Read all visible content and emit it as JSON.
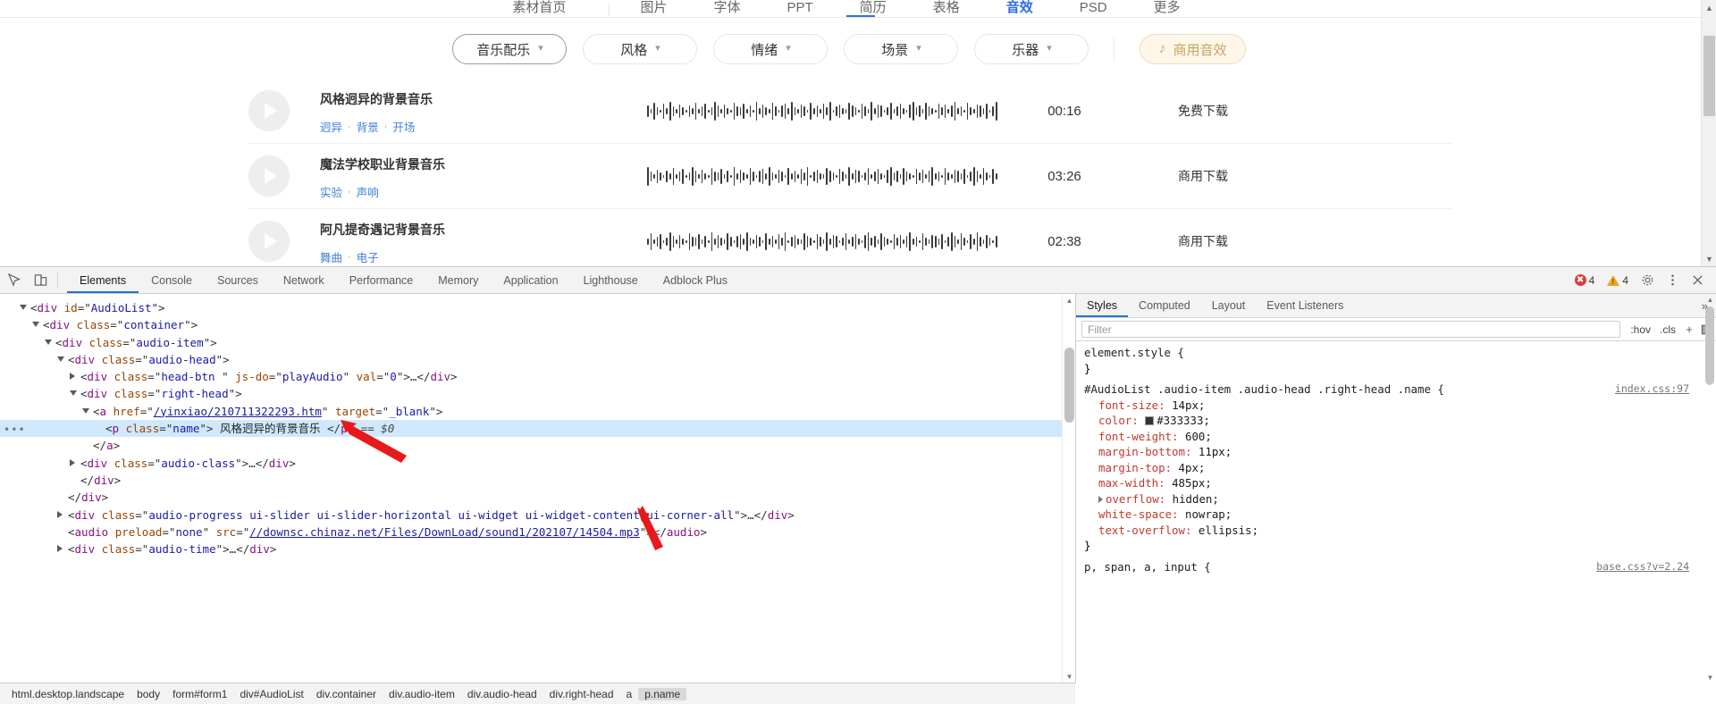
{
  "page": {
    "topnav": {
      "items": [
        "素材首页",
        "图片",
        "字体",
        "PPT",
        "简历",
        "表格",
        "音效",
        "PSD",
        "更多"
      ],
      "active": "音效",
      "more_label": "更多"
    },
    "filters": [
      {
        "label": "音乐配乐",
        "chevron": "chevron-down-icon",
        "selected": true
      },
      {
        "label": "风格",
        "chevron": "chevron-down-icon",
        "selected": false
      },
      {
        "label": "情绪",
        "chevron": "chevron-down-icon",
        "selected": false
      },
      {
        "label": "场景",
        "chevron": "chevron-down-icon",
        "selected": false
      },
      {
        "label": "乐器",
        "chevron": "chevron-down-icon",
        "selected": false
      }
    ],
    "commercial_button": {
      "label": "商用音效",
      "icon": "music-note-icon",
      "color": "#c8a35e",
      "bg": "#fdf6e9"
    },
    "audio_items": [
      {
        "name": "风格迥异的背景音乐",
        "tags": [
          "迥异",
          "背景",
          "开场"
        ],
        "time": "00:16",
        "download": "免费下载",
        "play": "play-icon"
      },
      {
        "name": "魔法学校职业背景音乐",
        "tags": [
          "实验",
          "声响"
        ],
        "time": "03:26",
        "download": "商用下载",
        "play": "play-icon"
      },
      {
        "name": "阿凡提奇遇记背景音乐",
        "tags": [
          "舞曲",
          "电子"
        ],
        "time": "02:38",
        "download": "商用下载",
        "play": "play-icon"
      }
    ]
  },
  "devtools": {
    "toolbar": {
      "inspect_icon": "inspect-element-icon",
      "device_icon": "device-toolbar-icon",
      "tabs": [
        "Elements",
        "Console",
        "Sources",
        "Network",
        "Performance",
        "Memory",
        "Application",
        "Lighthouse",
        "Adblock Plus"
      ],
      "active_tab": "Elements",
      "error_count": "4",
      "warning_count": "4",
      "settings_icon": "gear-icon",
      "more_icon": "kebab-menu-icon",
      "close_icon": "close-icon"
    },
    "dom_lines": [
      {
        "indent": 0,
        "marker": "open",
        "parts": [
          {
            "t": "pk",
            "v": "<"
          },
          {
            "t": "tg",
            "v": "div"
          },
          {
            "t": "pk",
            "v": " "
          },
          {
            "t": "at",
            "v": "id"
          },
          {
            "t": "pk",
            "v": "=\""
          },
          {
            "t": "vl",
            "v": "AudioList"
          },
          {
            "t": "pk",
            "v": "\">"
          }
        ]
      },
      {
        "indent": 1,
        "marker": "open",
        "parts": [
          {
            "t": "pk",
            "v": "<"
          },
          {
            "t": "tg",
            "v": "div"
          },
          {
            "t": "pk",
            "v": " "
          },
          {
            "t": "at",
            "v": "class"
          },
          {
            "t": "pk",
            "v": "=\""
          },
          {
            "t": "vl",
            "v": "container"
          },
          {
            "t": "pk",
            "v": "\">"
          }
        ]
      },
      {
        "indent": 2,
        "marker": "open",
        "parts": [
          {
            "t": "pk",
            "v": "<"
          },
          {
            "t": "tg",
            "v": "div"
          },
          {
            "t": "pk",
            "v": " "
          },
          {
            "t": "at",
            "v": "class"
          },
          {
            "t": "pk",
            "v": "=\""
          },
          {
            "t": "vl",
            "v": "audio-item"
          },
          {
            "t": "pk",
            "v": "\">"
          }
        ]
      },
      {
        "indent": 3,
        "marker": "open",
        "parts": [
          {
            "t": "pk",
            "v": "<"
          },
          {
            "t": "tg",
            "v": "div"
          },
          {
            "t": "pk",
            "v": " "
          },
          {
            "t": "at",
            "v": "class"
          },
          {
            "t": "pk",
            "v": "=\""
          },
          {
            "t": "vl",
            "v": "audio-head"
          },
          {
            "t": "pk",
            "v": "\">"
          }
        ]
      },
      {
        "indent": 4,
        "marker": "closed",
        "parts": [
          {
            "t": "pk",
            "v": "<"
          },
          {
            "t": "tg",
            "v": "div"
          },
          {
            "t": "pk",
            "v": " "
          },
          {
            "t": "at",
            "v": "class"
          },
          {
            "t": "pk",
            "v": "=\""
          },
          {
            "t": "vl",
            "v": "head-btn "
          },
          {
            "t": "pk",
            "v": "\" "
          },
          {
            "t": "at",
            "v": "js-do"
          },
          {
            "t": "pk",
            "v": "=\""
          },
          {
            "t": "vl",
            "v": "playAudio"
          },
          {
            "t": "pk",
            "v": "\" "
          },
          {
            "t": "at",
            "v": "val"
          },
          {
            "t": "pk",
            "v": "=\""
          },
          {
            "t": "vl",
            "v": "0"
          },
          {
            "t": "pk",
            "v": "\">…</"
          },
          {
            "t": "tg",
            "v": "div"
          },
          {
            "t": "pk",
            "v": ">"
          }
        ]
      },
      {
        "indent": 4,
        "marker": "open",
        "parts": [
          {
            "t": "pk",
            "v": "<"
          },
          {
            "t": "tg",
            "v": "div"
          },
          {
            "t": "pk",
            "v": " "
          },
          {
            "t": "at",
            "v": "class"
          },
          {
            "t": "pk",
            "v": "=\""
          },
          {
            "t": "vl",
            "v": "right-head"
          },
          {
            "t": "pk",
            "v": "\">"
          }
        ]
      },
      {
        "indent": 5,
        "marker": "open",
        "parts": [
          {
            "t": "pk",
            "v": "<"
          },
          {
            "t": "tg",
            "v": "a"
          },
          {
            "t": "pk",
            "v": " "
          },
          {
            "t": "at",
            "v": "href"
          },
          {
            "t": "pk",
            "v": "=\""
          },
          {
            "t": "lnk",
            "v": "/yinxiao/210711322293.htm"
          },
          {
            "t": "pk",
            "v": "\" "
          },
          {
            "t": "at",
            "v": "target"
          },
          {
            "t": "pk",
            "v": "=\""
          },
          {
            "t": "vl",
            "v": "_blank"
          },
          {
            "t": "pk",
            "v": "\">"
          }
        ]
      },
      {
        "indent": 6,
        "marker": "none",
        "selected": true,
        "ellipsis": true,
        "parts": [
          {
            "t": "pk",
            "v": "<"
          },
          {
            "t": "tg",
            "v": "p"
          },
          {
            "t": "pk",
            "v": " "
          },
          {
            "t": "at",
            "v": "class"
          },
          {
            "t": "pk",
            "v": "=\""
          },
          {
            "t": "vl",
            "v": "name"
          },
          {
            "t": "pk",
            "v": "\">"
          },
          {
            "t": "txt",
            "v": " 风格迥异的背景音乐 "
          },
          {
            "t": "pk",
            "v": "</"
          },
          {
            "t": "tg",
            "v": "p"
          },
          {
            "t": "pk",
            "v": "> "
          },
          {
            "t": "eq",
            "v": "== $0"
          }
        ]
      },
      {
        "indent": 5,
        "marker": "none",
        "parts": [
          {
            "t": "pk",
            "v": "</"
          },
          {
            "t": "tg",
            "v": "a"
          },
          {
            "t": "pk",
            "v": ">"
          }
        ]
      },
      {
        "indent": 4,
        "marker": "closed",
        "parts": [
          {
            "t": "pk",
            "v": "<"
          },
          {
            "t": "tg",
            "v": "div"
          },
          {
            "t": "pk",
            "v": " "
          },
          {
            "t": "at",
            "v": "class"
          },
          {
            "t": "pk",
            "v": "=\""
          },
          {
            "t": "vl",
            "v": "audio-class"
          },
          {
            "t": "pk",
            "v": "\">…</"
          },
          {
            "t": "tg",
            "v": "div"
          },
          {
            "t": "pk",
            "v": ">"
          }
        ]
      },
      {
        "indent": 4,
        "marker": "none",
        "parts": [
          {
            "t": "pk",
            "v": "</"
          },
          {
            "t": "tg",
            "v": "div"
          },
          {
            "t": "pk",
            "v": ">"
          }
        ]
      },
      {
        "indent": 3,
        "marker": "none",
        "parts": [
          {
            "t": "pk",
            "v": "</"
          },
          {
            "t": "tg",
            "v": "div"
          },
          {
            "t": "pk",
            "v": ">"
          }
        ]
      },
      {
        "indent": 3,
        "marker": "closed",
        "parts": [
          {
            "t": "pk",
            "v": "<"
          },
          {
            "t": "tg",
            "v": "div"
          },
          {
            "t": "pk",
            "v": " "
          },
          {
            "t": "at",
            "v": "class"
          },
          {
            "t": "pk",
            "v": "=\""
          },
          {
            "t": "vl",
            "v": "audio-progress ui-slider ui-slider-horizontal ui-widget ui-widget-content ui-corner-all"
          },
          {
            "t": "pk",
            "v": "\">…</"
          },
          {
            "t": "tg",
            "v": "div"
          },
          {
            "t": "pk",
            "v": ">"
          }
        ]
      },
      {
        "indent": 3,
        "marker": "none",
        "parts": [
          {
            "t": "pk",
            "v": "<"
          },
          {
            "t": "tg",
            "v": "audio"
          },
          {
            "t": "pk",
            "v": " "
          },
          {
            "t": "at",
            "v": "preload"
          },
          {
            "t": "pk",
            "v": "=\""
          },
          {
            "t": "vl",
            "v": "none"
          },
          {
            "t": "pk",
            "v": "\" "
          },
          {
            "t": "at",
            "v": "src"
          },
          {
            "t": "pk",
            "v": "=\""
          },
          {
            "t": "lnk",
            "v": "//downsc.chinaz.net/Files/DownLoad/sound1/202107/14504.mp3"
          },
          {
            "t": "pk",
            "v": "\"></"
          },
          {
            "t": "tg",
            "v": "audio"
          },
          {
            "t": "pk",
            "v": ">"
          }
        ]
      },
      {
        "indent": 3,
        "marker": "closed",
        "parts": [
          {
            "t": "pk",
            "v": "<"
          },
          {
            "t": "tg",
            "v": "div"
          },
          {
            "t": "pk",
            "v": " "
          },
          {
            "t": "at",
            "v": "class"
          },
          {
            "t": "pk",
            "v": "=\""
          },
          {
            "t": "vl",
            "v": "audio-time"
          },
          {
            "t": "pk",
            "v": "\">…</"
          },
          {
            "t": "tg",
            "v": "div"
          },
          {
            "t": "pk",
            "v": ">"
          }
        ]
      }
    ],
    "breadcrumb": [
      {
        "label": "html.desktop.landscape",
        "selected": false
      },
      {
        "label": "body",
        "selected": false
      },
      {
        "label": "form#form1",
        "selected": false
      },
      {
        "label": "div#AudioList",
        "selected": false
      },
      {
        "label": "div.container",
        "selected": false
      },
      {
        "label": "div.audio-item",
        "selected": false
      },
      {
        "label": "div.audio-head",
        "selected": false
      },
      {
        "label": "div.right-head",
        "selected": false
      },
      {
        "label": "a",
        "selected": false
      },
      {
        "label": "p.name",
        "selected": true
      }
    ],
    "styles": {
      "tabs": [
        "Styles",
        "Computed",
        "Layout",
        "Event Listeners"
      ],
      "active_tab": "Styles",
      "more_icon": "chevron-double-right-icon",
      "filter_placeholder": "Filter",
      "hov_label": ":hov",
      "cls_label": ".cls",
      "plus_label": "+",
      "sidebar_icon": "toggle-sidebar-icon",
      "rules": [
        {
          "selector": "element.style {",
          "source": "",
          "declarations": [],
          "closing": "}"
        },
        {
          "selector": "#AudioList .audio-item .audio-head .right-head .name {",
          "source": "index.css:97",
          "declarations": [
            {
              "prop": "font-size",
              "value": "14px;"
            },
            {
              "prop": "color",
              "value": "#333333;",
              "swatch": "#333333"
            },
            {
              "prop": "font-weight",
              "value": "600;"
            },
            {
              "prop": "margin-bottom",
              "value": "11px;"
            },
            {
              "prop": "margin-top",
              "value": "4px;"
            },
            {
              "prop": "max-width",
              "value": "485px;"
            },
            {
              "prop": "overflow",
              "value": "hidden;",
              "expandable": true
            },
            {
              "prop": "white-space",
              "value": "nowrap;"
            },
            {
              "prop": "text-overflow",
              "value": "ellipsis;"
            }
          ],
          "closing": "}"
        },
        {
          "selector": "p, span, a, input {",
          "source": "base.css?v=2.24",
          "declarations": [],
          "closing": ""
        }
      ]
    }
  }
}
